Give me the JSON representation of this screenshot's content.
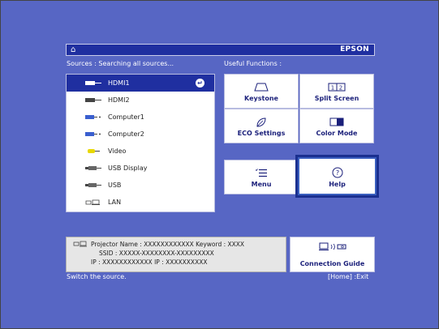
{
  "topbar": {
    "brand": "EPSON"
  },
  "sources": {
    "header": "Sources : Searching all sources...",
    "items": [
      {
        "label": "HDMI1",
        "icon": "hdmi-icon",
        "selected": true
      },
      {
        "label": "HDMI2",
        "icon": "hdmi-icon"
      },
      {
        "label": "Computer1",
        "icon": "computer-port-icon"
      },
      {
        "label": "Computer2",
        "icon": "computer-port-icon"
      },
      {
        "label": "Video",
        "icon": "video-port-icon"
      },
      {
        "label": "USB Display",
        "icon": "usb-display-icon"
      },
      {
        "label": "USB",
        "icon": "usb-icon"
      },
      {
        "label": "LAN",
        "icon": "lan-icon"
      }
    ]
  },
  "functions": {
    "header": "Useful Functions :",
    "keystone": "Keystone",
    "split": "Split Screen",
    "eco": "ECO Settings",
    "color": "Color Mode",
    "menu": "Menu",
    "help": "Help",
    "split_icon_text": "1|2"
  },
  "info": {
    "line1": "Projector Name : XXXXXXXXXXXX     Keyword : XXXX",
    "line2": "SSID : XXXXX-XXXXXXXX-XXXXXXXXX",
    "line3": "IP : XXXXXXXXXXXX    IP : XXXXXXXXXX"
  },
  "connection_guide": "Connection Guide",
  "status": {
    "left": "Switch the source.",
    "right": "[Home] :Exit"
  },
  "colors": {
    "background": "#5766c4",
    "accent": "#1f2fa0",
    "highlight_border": "#1a2f8f"
  }
}
